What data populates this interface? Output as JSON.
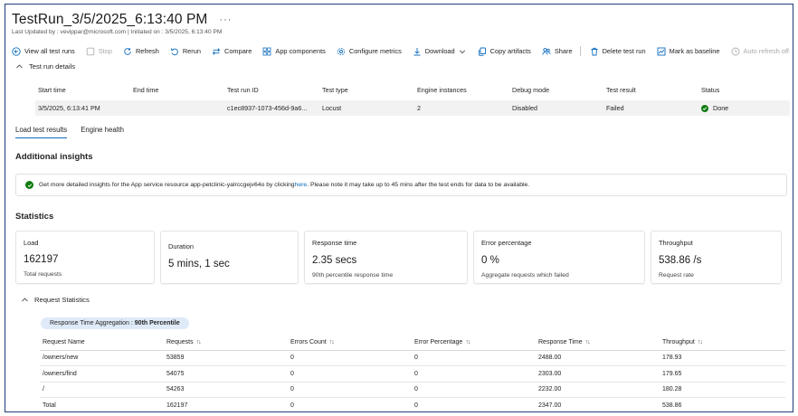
{
  "header": {
    "title": "TestRun_3/5/2025_6:13:40 PM",
    "more": "···",
    "subtitle": "Last Updated by : vevippar@microsoft.com | Initiated on : 3/5/2025, 6:13:40 PM"
  },
  "toolbar": {
    "view_all": "View all test runs",
    "stop": "Stop",
    "refresh": "Refresh",
    "rerun": "Rerun",
    "compare": "Compare",
    "app_components": "App components",
    "configure_metrics": "Configure metrics",
    "download": "Download",
    "copy_artifacts": "Copy artifacts",
    "share": "Share",
    "delete": "Delete test run",
    "mark_baseline": "Mark as baseline",
    "auto_refresh": "Auto refresh off"
  },
  "details": {
    "section_label": "Test run details",
    "columns": [
      "Start time",
      "End time",
      "Test run ID",
      "Test type",
      "Engine instances",
      "Debug mode",
      "Test result",
      "Status"
    ],
    "row": {
      "start_time": "3/5/2025, 6:13:41 PM",
      "end_time": "",
      "test_run_id": "c1ec8937-1073-456d-9a6...",
      "test_type": "Locust",
      "engine_instances": "2",
      "debug_mode": "Disabled",
      "test_result": "Failed",
      "status": "Done"
    },
    "status_color": "#107c10"
  },
  "tabs": [
    {
      "label": "Load test results",
      "active": true
    },
    {
      "label": "Engine health",
      "active": false
    }
  ],
  "insights": {
    "heading": "Additional insights",
    "text_before": "Get more detailed insights for the App service resource app-petclinic-yalrccgejv64o by clicking ",
    "link": "here",
    "text_after": ". Please note it may take up to 45 mins after the test ends for data to be available."
  },
  "statistics": {
    "heading": "Statistics",
    "cards": [
      {
        "title": "Load",
        "value": "162197",
        "sub": "Total requests"
      },
      {
        "title": "Duration",
        "value": "5 mins, 1 sec",
        "sub": ""
      },
      {
        "title": "Response time",
        "value": "2.35 secs",
        "sub": "90th percentile response time"
      },
      {
        "title": "Error percentage",
        "value": "0 %",
        "sub": "Aggregate requests which failed"
      },
      {
        "title": "Throughput",
        "value": "538.86 /s",
        "sub": "Request rate"
      }
    ]
  },
  "request_stats": {
    "section_label": "Request Statistics",
    "aggregation_label": "Response Time Aggregation : ",
    "aggregation_value": "90th Percentile",
    "columns": [
      "Request Name",
      "Requests",
      "Errors Count",
      "Error Percentage",
      "Response Time",
      "Throughput"
    ],
    "sortable": [
      false,
      true,
      true,
      true,
      true,
      true
    ],
    "rows": [
      [
        "/owners/new",
        "53859",
        "0",
        "0",
        "2488.00",
        "178.93"
      ],
      [
        "/owners/find",
        "54075",
        "0",
        "0",
        "2303.00",
        "179.65"
      ],
      [
        "/",
        "54263",
        "0",
        "0",
        "2232.00",
        "180.28"
      ],
      [
        "Total",
        "162197",
        "0",
        "0",
        "2347.00",
        "538.86"
      ]
    ]
  },
  "colors": {
    "accent": "#0f6cbd",
    "success": "#107c10",
    "frame": "#1f3c78",
    "pill": "#dfeaf8"
  }
}
